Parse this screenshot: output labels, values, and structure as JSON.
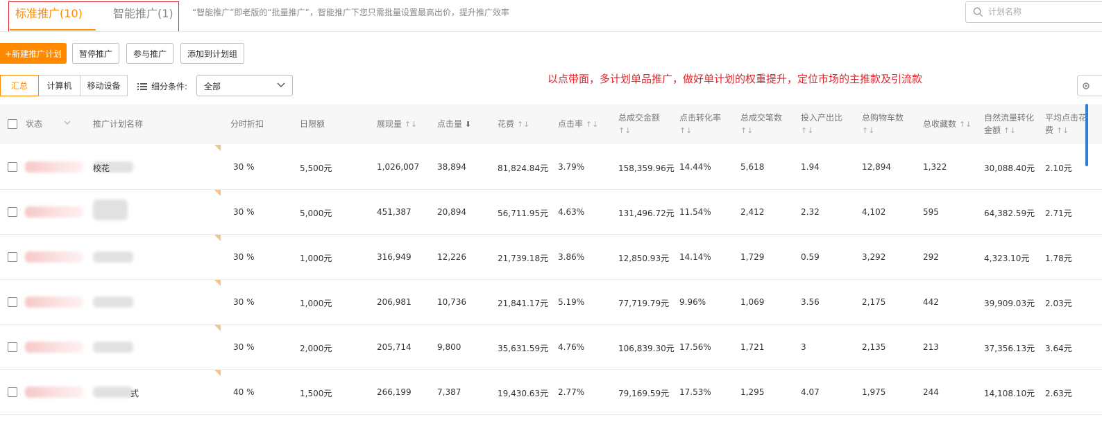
{
  "tabs": [
    {
      "label": "标准推广(10)",
      "active": true
    },
    {
      "label": "智能推广(1)",
      "active": false
    }
  ],
  "hint": "“智能推广”即老版的“批量推广”，智能推广下您只需批量设置最高出价，提升推广效率",
  "search": {
    "placeholder": "计划名称",
    "value": ""
  },
  "toolbar": {
    "new_plan": "+新建推广计划",
    "pause": "暂停推广",
    "join": "参与推广",
    "add_group": "添加到计划组"
  },
  "device_tabs": [
    {
      "label": "汇总",
      "active": true
    },
    {
      "label": "计算机",
      "active": false
    },
    {
      "label": "移动设备",
      "active": false
    }
  ],
  "filter": {
    "label": "细分条件:",
    "selected": "全部"
  },
  "annotation": "以点带面，多计划单品推广，做好单计划的权重提升，定位市场的主推款及引流款",
  "colors": {
    "accent": "#ff8a00",
    "annotation": "#e0242a",
    "blue_edge": "#2d7fd6"
  },
  "table": {
    "headers": {
      "status": "状态",
      "plan_name": "推广计划名称",
      "time_discount": "分时折扣",
      "daily_limit": "日限额",
      "impressions": "展现量",
      "clicks": "点击量",
      "cost": "花费",
      "ctr": "点击率",
      "total_gmv": "总成交金额",
      "cvr": "点击转化率",
      "total_orders": "总成交笔数",
      "roi": "投入产出比",
      "total_cart": "总购物车数",
      "total_fav": "总收藏数",
      "natural_gmv_line1": "自然流量转化",
      "natural_gmv_line2": "金额",
      "avg_cpc_line1": "平均点击花",
      "avg_cpc_line2": "费"
    },
    "rows": [
      {
        "name": "校花",
        "discount": "30 %",
        "limit": "5,500元",
        "impressions": "1,026,007",
        "clicks": "38,894",
        "cost": "81,824.84元",
        "ctr": "3.79%",
        "gmv": "158,359.96元",
        "cvr": "14.44%",
        "orders": "5,618",
        "roi": "1.94",
        "cart": "12,894",
        "fav": "1,322",
        "natural": "30,088.40元",
        "cpc": "2.10元"
      },
      {
        "name": "",
        "discount": "30 %",
        "limit": "5,000元",
        "impressions": "451,387",
        "clicks": "20,894",
        "cost": "56,711.95元",
        "ctr": "4.63%",
        "gmv": "131,496.72元",
        "cvr": "11.54%",
        "orders": "2,412",
        "roi": "2.32",
        "cart": "4,102",
        "fav": "595",
        "natural": "64,382.59元",
        "cpc": "2.71元"
      },
      {
        "name": "",
        "discount": "30 %",
        "limit": "1,000元",
        "impressions": "316,949",
        "clicks": "12,226",
        "cost": "21,739.18元",
        "ctr": "3.86%",
        "gmv": "12,850.93元",
        "cvr": "14.14%",
        "orders": "1,729",
        "roi": "0.59",
        "cart": "3,292",
        "fav": "292",
        "natural": "4,323.10元",
        "cpc": "1.78元"
      },
      {
        "name": "",
        "discount": "30 %",
        "limit": "1,000元",
        "impressions": "206,981",
        "clicks": "10,736",
        "cost": "21,841.17元",
        "ctr": "5.19%",
        "gmv": "77,719.79元",
        "cvr": "9.96%",
        "orders": "1,069",
        "roi": "3.56",
        "cart": "2,175",
        "fav": "442",
        "natural": "39,909.03元",
        "cpc": "2.03元"
      },
      {
        "name": "",
        "discount": "30 %",
        "limit": "2,000元",
        "impressions": "205,714",
        "clicks": "9,800",
        "cost": "35,631.59元",
        "ctr": "4.76%",
        "gmv": "106,839.30元",
        "cvr": "17.56%",
        "orders": "1,721",
        "roi": "3",
        "cart": "2,135",
        "fav": "213",
        "natural": "37,356.13元",
        "cpc": "3.64元"
      },
      {
        "name": "式",
        "discount": "40 %",
        "limit": "1,500元",
        "impressions": "266,199",
        "clicks": "7,387",
        "cost": "19,430.63元",
        "ctr": "2.77%",
        "gmv": "79,169.59元",
        "cvr": "17.53%",
        "orders": "1,295",
        "roi": "4.07",
        "cart": "1,975",
        "fav": "244",
        "natural": "14,108.10元",
        "cpc": "2.63元"
      }
    ]
  }
}
